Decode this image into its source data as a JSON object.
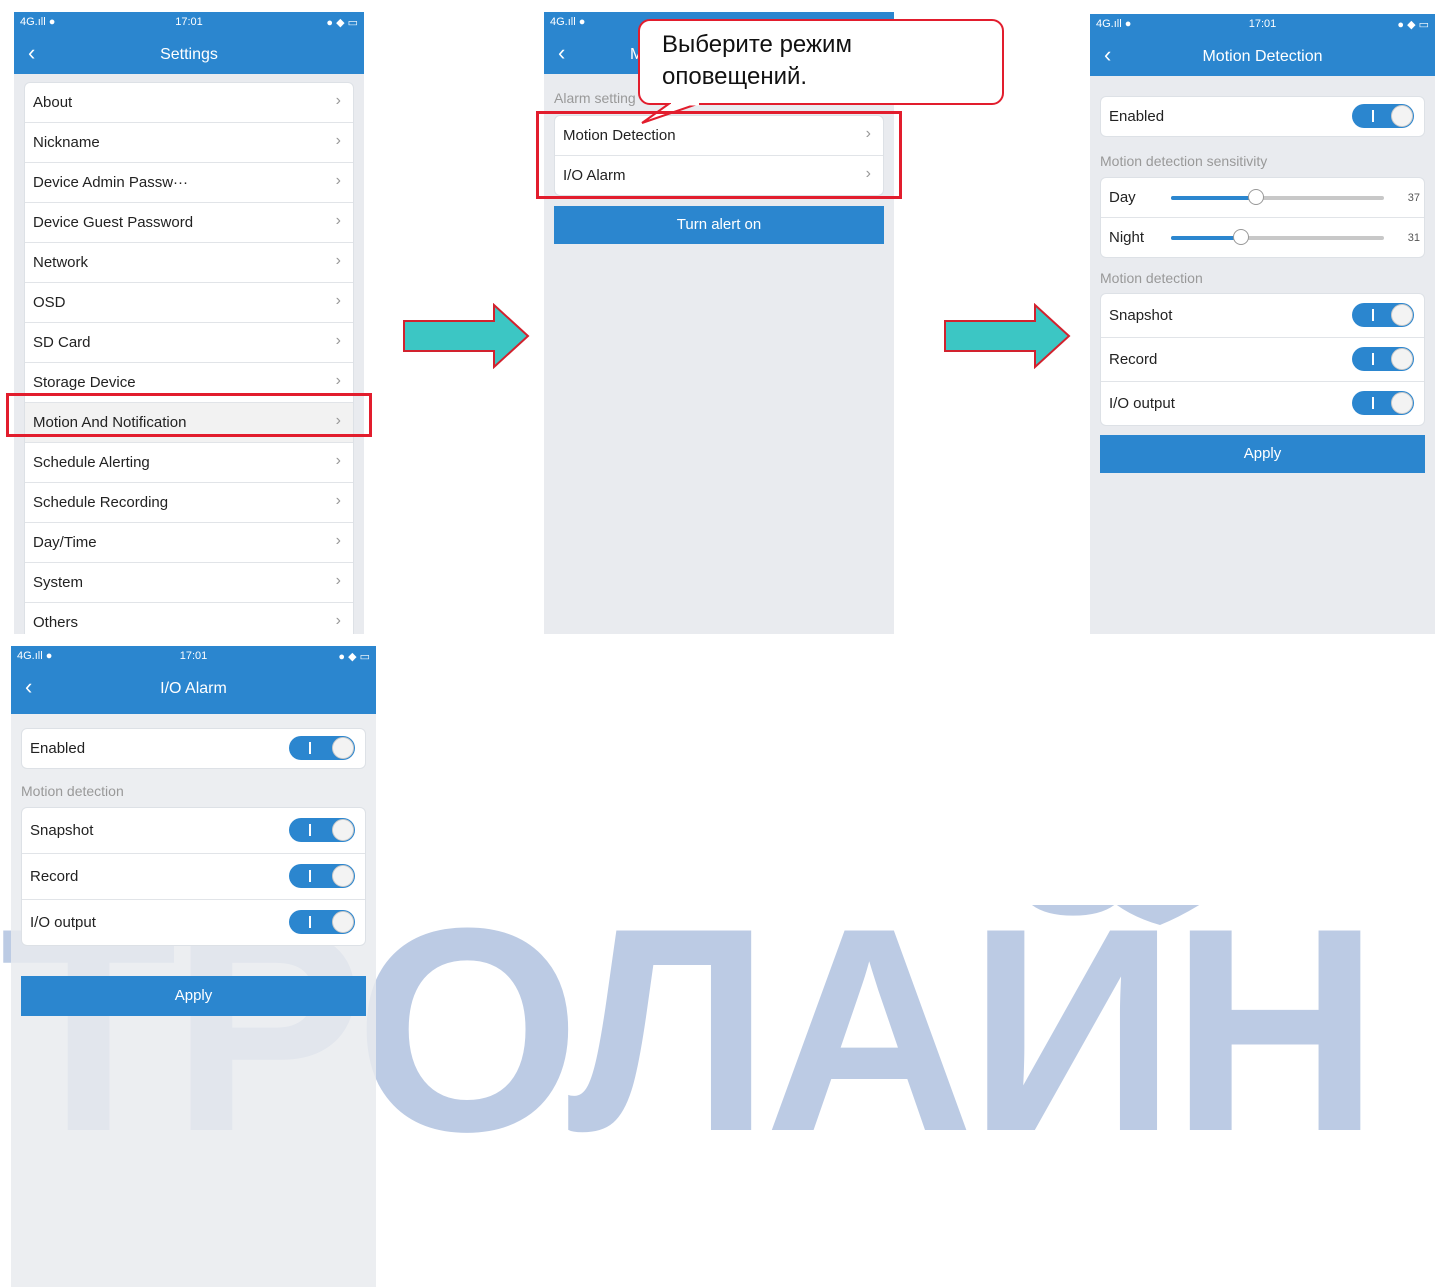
{
  "status_bar": {
    "signal": "4G.ıll ●",
    "time": "17:01",
    "battery": "● ◆ ▭"
  },
  "callout_text": "Выберите режим оповещений.",
  "watermark_text": "ТРОЛАЙН",
  "settings_screen": {
    "title": "Settings",
    "items": [
      "About",
      "Nickname",
      "Device Admin Passw···",
      "Device Guest Password",
      "Network",
      "OSD",
      "SD Card",
      "Storage Device",
      "Motion And Notification",
      "Schedule Alerting",
      "Schedule Recording",
      "Day/Time",
      "System",
      "Others"
    ],
    "highlighted_item": "Motion And Notification"
  },
  "alarm_screen": {
    "title_partial": "M",
    "section_label": "Alarm setting",
    "items": [
      "Motion Detection",
      "I/O Alarm"
    ],
    "button": "Turn alert on"
  },
  "motion_screen": {
    "title": "Motion Detection",
    "enabled_label": "Enabled",
    "sensitivity_label": "Motion detection sensitivity",
    "day_label": "Day",
    "day_value": "37",
    "day_fraction": 0.4,
    "night_label": "Night",
    "night_value": "31",
    "night_fraction": 0.33,
    "section_label": "Motion detection",
    "toggles": [
      "Snapshot",
      "Record",
      "I/O output"
    ],
    "apply": "Apply"
  },
  "io_screen": {
    "title": "I/O Alarm",
    "enabled_label": "Enabled",
    "section_label": "Motion detection",
    "toggles": [
      "Snapshot",
      "Record",
      "I/O output"
    ],
    "apply": "Apply"
  }
}
